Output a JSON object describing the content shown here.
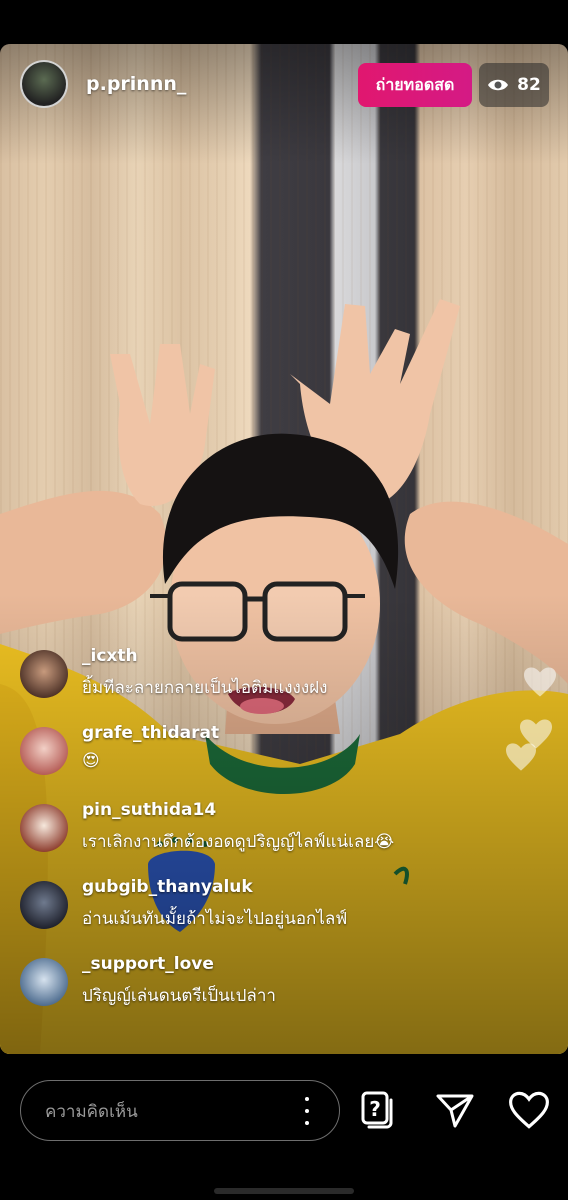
{
  "header": {
    "username": "p.prinnn_",
    "live_label": "ถ่ายทอดสด",
    "viewer_count": "82"
  },
  "comments": [
    {
      "username": "_icxth",
      "text": "ยิ้มทีละลายกลายเป็นไอติมแงงงฝง"
    },
    {
      "username": "grafe_thidarat",
      "text": "😍"
    },
    {
      "username": "pin_suthida14",
      "text": "เราเลิกงานดึกต้องอดดูปริญญ์ไลฟ์แน่เลย😭"
    },
    {
      "username": "gubgib_thanyaluk",
      "text": "อ่านเม้นทันมั้ยถ้าไม่จะไปอยู่นอกไลฟ์"
    },
    {
      "username": "_support_love",
      "text": "ปริญญ์เล่นดนตรีเป็นเปล่าา"
    }
  ],
  "bottom_bar": {
    "comment_placeholder": "ความคิดเห็น"
  },
  "icons": {
    "viewer": "eye-icon",
    "more": "more-vertical-icon",
    "questions": "question-cards-icon",
    "share": "send-icon",
    "like": "heart-icon"
  },
  "colors": {
    "live_badge": "#e1176f",
    "background": "#000000"
  }
}
